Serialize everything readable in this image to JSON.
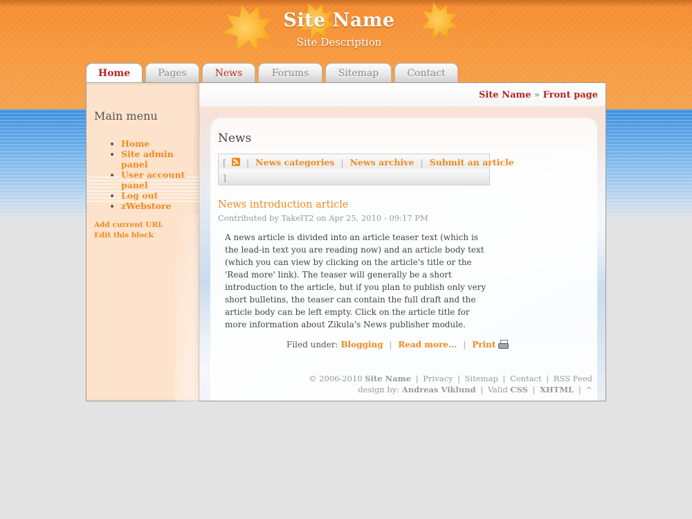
{
  "header": {
    "site_title": "Site Name",
    "site_description": "Site Description"
  },
  "tabs": [
    {
      "label": "Home",
      "active": true
    },
    {
      "label": "Pages",
      "active": false
    },
    {
      "label": "News",
      "active": false
    },
    {
      "label": "Forums",
      "active": false
    },
    {
      "label": "Sitemap",
      "active": false
    },
    {
      "label": "Contact",
      "active": false
    }
  ],
  "breadcrumb": {
    "site": "Site Name",
    "separator": "»",
    "page": "Front page"
  },
  "sidebar": {
    "menu_title": "Main menu",
    "items": [
      {
        "label": "Home"
      },
      {
        "label": "Site admin panel"
      },
      {
        "label": "User account panel"
      },
      {
        "label": "Log out"
      },
      {
        "label": "zWebstore"
      }
    ],
    "links": [
      {
        "label": "Add current URL"
      },
      {
        "label": "Edit this block"
      }
    ]
  },
  "content": {
    "page_title": "News",
    "nav": {
      "open_bracket": "[",
      "close_bracket": "]",
      "links": [
        {
          "label": "News categories"
        },
        {
          "label": "News archive"
        },
        {
          "label": "Submit an article"
        }
      ],
      "icon": "rss-icon"
    },
    "article": {
      "title": "News introduction article",
      "meta": "Contributed by TakeIT2 on Apr 25, 2010 - 09:17 PM",
      "body": "A news article is divided into an article teaser text (which is the lead-in text you are reading now) and an article body text (which you can view by clicking on the article's title or the 'Read more' link). The teaser will generally be a short introduction to the article, but if you plan to publish only very short bulletins, the teaser can contain the full draft and the article body can be left empty. Click on the article title for more information about Zikula's News publisher module.",
      "filed_under_label": "Filed under:",
      "category": "Blogging",
      "read_more": "Read more...",
      "print": "Print",
      "print_icon": "printer-icon"
    }
  },
  "footer": {
    "copyright": "© 2006-2010",
    "site": "Site Name",
    "links": [
      "Privacy",
      "Sitemap",
      "Contact",
      "RSS Feed"
    ],
    "design_by_label": "design by:",
    "designer": "Andreas Viklund",
    "valid_label": "Valid",
    "css": "CSS",
    "xhtml": "XHTML",
    "top": "^"
  },
  "colors": {
    "accent": "#f08a1e",
    "dark_red": "#b3261e",
    "sidebar_bg": "#fde2cc",
    "header_orange": "#f58a2f"
  }
}
